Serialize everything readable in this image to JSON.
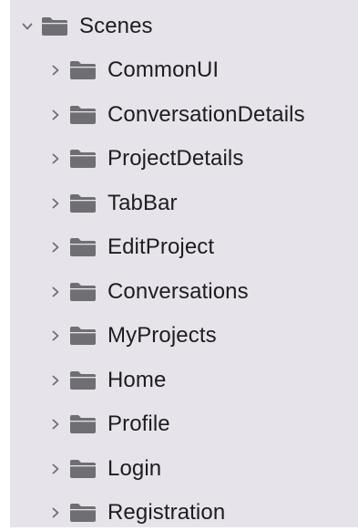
{
  "tree": {
    "root": {
      "label": "Scenes",
      "expanded": true,
      "icon": "folder-icon"
    },
    "children": [
      {
        "label": "CommonUI",
        "expanded": false,
        "icon": "folder-icon"
      },
      {
        "label": "ConversationDetails",
        "expanded": false,
        "icon": "folder-icon"
      },
      {
        "label": "ProjectDetails",
        "expanded": false,
        "icon": "folder-icon"
      },
      {
        "label": "TabBar",
        "expanded": false,
        "icon": "folder-icon"
      },
      {
        "label": "EditProject",
        "expanded": false,
        "icon": "folder-icon"
      },
      {
        "label": "Conversations",
        "expanded": false,
        "icon": "folder-icon"
      },
      {
        "label": "MyProjects",
        "expanded": false,
        "icon": "folder-icon"
      },
      {
        "label": "Home",
        "expanded": false,
        "icon": "folder-icon"
      },
      {
        "label": "Profile",
        "expanded": false,
        "icon": "folder-icon"
      },
      {
        "label": "Login",
        "expanded": false,
        "icon": "folder-icon"
      },
      {
        "label": "Registration",
        "expanded": false,
        "icon": "folder-icon"
      }
    ]
  },
  "colors": {
    "panel_background": "#e7e3ea",
    "text": "#1d1d1f",
    "folder": "#6e6e73",
    "chevron": "#6e6e73"
  }
}
